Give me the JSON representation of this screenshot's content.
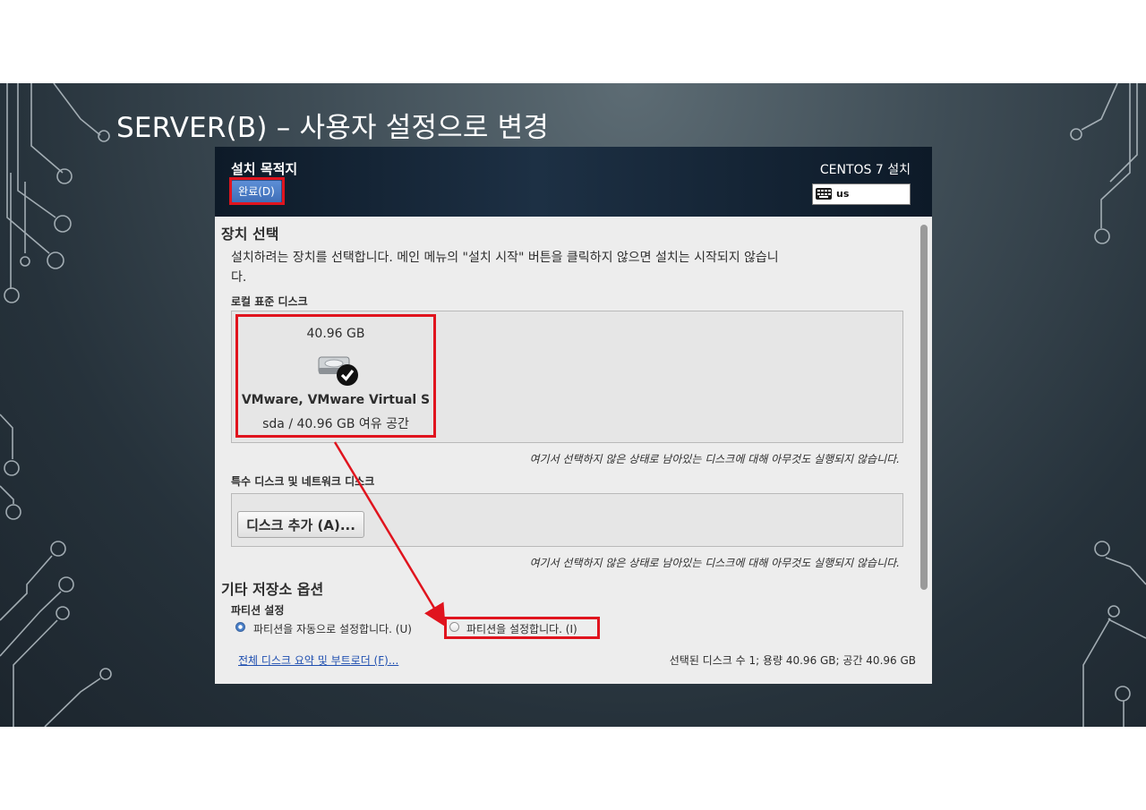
{
  "slide": {
    "title": "SERVER(B) – 사용자 설정으로 변경"
  },
  "window": {
    "header_title": "설치 목적지",
    "done_label": "완료(D)",
    "product_title": "CENTOS 7 설치",
    "keyboard_layout": "us"
  },
  "device_selection": {
    "heading": "장치 선택",
    "description_line1": "설치하려는 장치를 선택합니다. 메인 메뉴의 \"설치 시작\" 버튼을 클릭하지 않으면 설치는 시작되지 않습니",
    "description_line2": "다.",
    "local_disks_label": "로컬 표준 디스크",
    "disk": {
      "size": "40.96 GB",
      "name": "VMware, VMware Virtual S",
      "free": "sda  /  40.96 GB 여유 공간",
      "icon": "hard-disk-icon",
      "selected_icon": "checkmark-icon"
    },
    "untouched_note": "여기서 선택하지 않은 상태로 남아있는 디스크에 대해 아무것도 실행되지 않습니다.",
    "special_disks_label": "특수 디스크 및 네트워크 디스크",
    "add_disk_label": "디스크 추가 (A)...",
    "untouched_note2": "여기서 선택하지 않은 상태로 남아있는 디스크에 대해 아무것도 실행되지 않습니다."
  },
  "other_storage": {
    "heading": "기타 저장소 옵션",
    "partition_label": "파티션 설정",
    "auto_option": "파티션을 자동으로 설정합니다. (U)",
    "manual_option": "파티션을 설정합니다. (I)",
    "selected_option": "auto"
  },
  "footer": {
    "summary_link": "전체 디스크 요약 및 부트로더 (F)...",
    "summary_text": "선택된 디스크 수 1; 용량 40.96 GB; 공간 40.96 GB"
  },
  "colors": {
    "highlight": "#e0141e",
    "header_bg": "#1d3044",
    "done_button": "#4a80c8",
    "link": "#1f4fb0"
  }
}
